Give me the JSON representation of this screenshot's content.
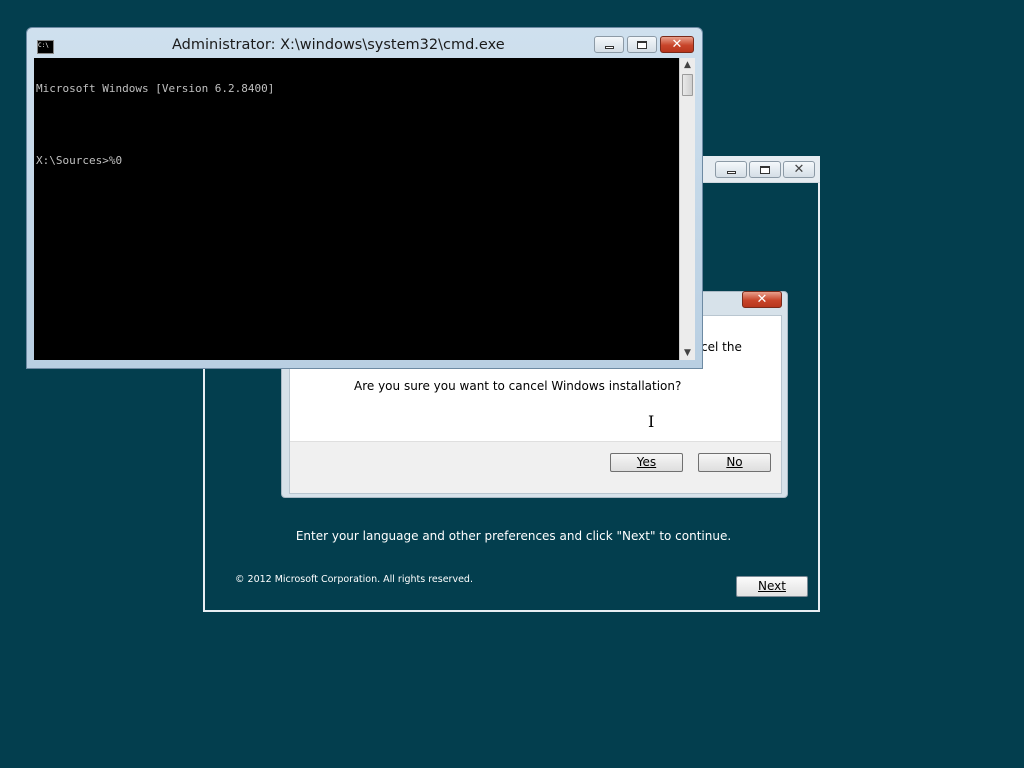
{
  "setup_window": {
    "instruction": "Enter your language and other preferences and click \"Next\" to continue.",
    "copyright": "© 2012 Microsoft Corporation. All rights reserved.",
    "next_label": "Next"
  },
  "confirm_dialog": {
    "partial_text": "cel the",
    "question": "Are you sure you want to cancel Windows installation?",
    "yes_label": "Yes",
    "no_label": "No"
  },
  "cmd_window": {
    "title": "Administrator: X:\\windows\\system32\\cmd.exe",
    "icon_text": "C:\\",
    "lines": [
      "Microsoft Windows [Version 6.2.8400]",
      "",
      "X:\\Sources>%0"
    ]
  },
  "colors": {
    "desktop": "#033e4e",
    "console_bg": "#000000",
    "console_text": "#c0c0c0",
    "close_button": "#c8452a"
  },
  "icons": {
    "minimize": "minimize-icon",
    "maximize": "maximize-icon",
    "close": "close-icon",
    "scroll_up": "▲",
    "scroll_down": "▼",
    "cursor": "I"
  }
}
